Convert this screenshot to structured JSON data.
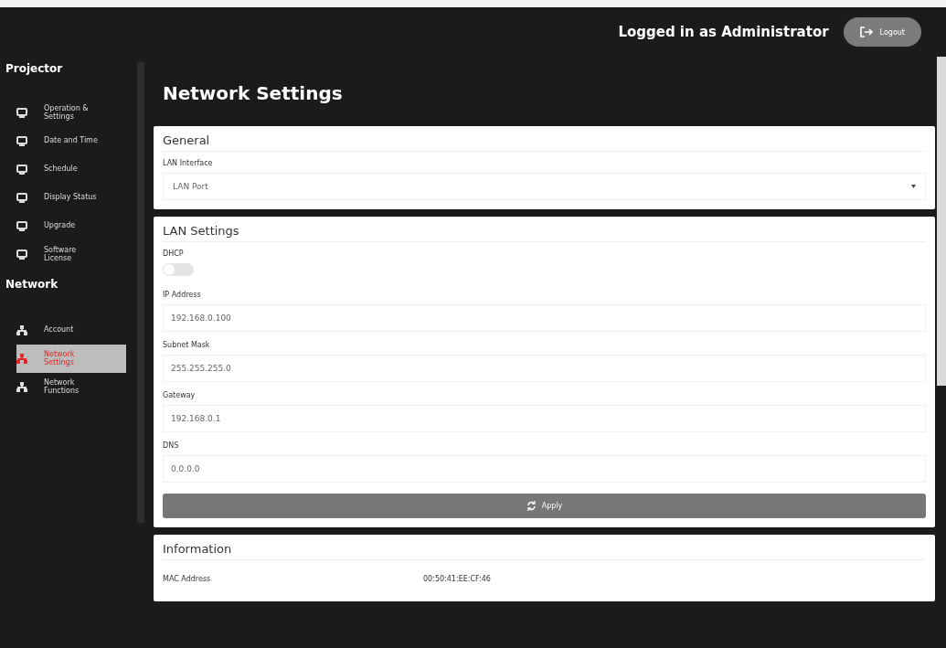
{
  "header": {
    "user_text": "Logged in as Administrator",
    "logout_button": "Logout"
  },
  "sidebar": {
    "sections": [
      {
        "heading": "Projector",
        "items": [
          {
            "label": "Operation & Settings",
            "kind": "monitor",
            "selected": false
          },
          {
            "label": "Date and Time",
            "kind": "monitor",
            "selected": false
          },
          {
            "label": "Schedule",
            "kind": "monitor",
            "selected": false
          },
          {
            "label": "Display Status",
            "kind": "monitor",
            "selected": false
          },
          {
            "label": "Upgrade",
            "kind": "monitor",
            "selected": false
          },
          {
            "label": "Software License",
            "kind": "monitor",
            "selected": false
          }
        ]
      },
      {
        "heading": "Network",
        "items": [
          {
            "label": "Account",
            "kind": "network",
            "selected": false
          },
          {
            "label": "Network Settings",
            "kind": "network",
            "selected": true
          },
          {
            "label": "Network Functions",
            "kind": "network",
            "selected": false
          }
        ]
      }
    ]
  },
  "page_title": "Network Settings",
  "general": {
    "title": "General",
    "lan_interface": {
      "label": "LAN Interface",
      "value": "LAN Port"
    }
  },
  "lan_settings": {
    "title": "LAN Settings",
    "dhcp": {
      "label": "DHCP",
      "on": false
    },
    "fields": [
      {
        "label": "IP Address",
        "value": "192.168.0.100"
      },
      {
        "label": "Subnet Mask",
        "value": "255.255.255.0"
      },
      {
        "label": "Gateway",
        "value": "192.168.0.1"
      },
      {
        "label": "DNS",
        "value": "0.0.0.0"
      }
    ],
    "apply_button": "Apply"
  },
  "information": {
    "title": "Information",
    "rows": [
      {
        "label": "MAC Address",
        "value": "00:50:41:EE:CF:46"
      }
    ]
  }
}
